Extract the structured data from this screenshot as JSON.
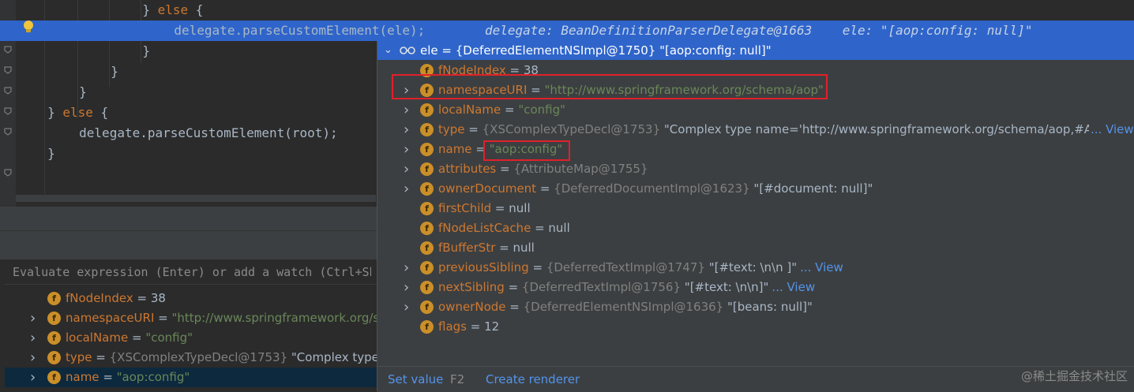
{
  "editor": {
    "lines": [
      {
        "indent": "                ",
        "parts": [
          {
            "t": "} ",
            "c": "plain"
          },
          {
            "t": "else",
            "c": "kw"
          },
          {
            "t": " {",
            "c": "plain"
          }
        ]
      },
      {
        "indent": "                    ",
        "parts": [
          {
            "t": "delegate.parseCustomElement(ele);",
            "c": "plain"
          }
        ],
        "highlight": true
      },
      {
        "indent": "                ",
        "parts": [
          {
            "t": "}",
            "c": "plain"
          }
        ]
      },
      {
        "indent": "            ",
        "parts": [
          {
            "t": "}",
            "c": "plain"
          }
        ]
      },
      {
        "indent": "        ",
        "parts": [
          {
            "t": "}",
            "c": "plain"
          }
        ]
      },
      {
        "indent": "    ",
        "parts": [
          {
            "t": "} ",
            "c": "plain"
          },
          {
            "t": "else",
            "c": "kw"
          },
          {
            "t": " {",
            "c": "plain"
          }
        ]
      },
      {
        "indent": "        ",
        "parts": [
          {
            "t": "delegate.parseCustomElement(root);",
            "c": "plain"
          }
        ]
      },
      {
        "indent": "    ",
        "parts": [
          {
            "t": "}",
            "c": "plain"
          }
        ]
      }
    ],
    "inline_hint": "delegate: BeanDefinitionParserDelegate@1663    ele: \"[aop:config: null]\""
  },
  "debug_panel": {
    "eval_placeholder": "Evaluate expression (Enter) or add a watch (Ctrl+Shift+Enter)",
    "rows": [
      {
        "expandable": false,
        "name": "fNodeIndex",
        "eq": " = ",
        "value": "38",
        "vclass": "plain"
      },
      {
        "expandable": true,
        "name": "namespaceURI",
        "eq": " = ",
        "value": "\"http://www.springframework.org/schema/aop\"",
        "vclass": "str"
      },
      {
        "expandable": true,
        "name": "localName",
        "eq": " = ",
        "value": "\"config\"",
        "vclass": "str"
      },
      {
        "expandable": true,
        "name": "type",
        "eq": " = ",
        "type": "{XSComplexTypeDecl@1753}",
        "value": " \"Complex type name='http://www.springframework.org/schema/aop,#AnonType_configType'\"",
        "vclass": "plain"
      },
      {
        "expandable": true,
        "name": "name",
        "eq": " = ",
        "value": "\"aop:config\"",
        "vclass": "str",
        "selected": true
      }
    ]
  },
  "popup": {
    "header": "ele = {DeferredElementNSImpl@1750} \"[aop:config: null]\"",
    "rows": [
      {
        "expandable": false,
        "name": "fNodeIndex",
        "eq": " = ",
        "value": "38",
        "vclass": "plain"
      },
      {
        "expandable": true,
        "name": "namespaceURI",
        "eq": " = ",
        "value": "\"http://www.springframework.org/schema/aop\"",
        "vclass": "str"
      },
      {
        "expandable": true,
        "name": "localName",
        "eq": " = ",
        "value": "\"config\"",
        "vclass": "str"
      },
      {
        "expandable": true,
        "name": "type",
        "eq": " = ",
        "type": "{XSComplexTypeDecl@1753}",
        "value": " \"Complex type name='http://www.springframework.org/schema/aop,#Anon",
        "vclass": "plain",
        "link": "... View"
      },
      {
        "expandable": true,
        "name": "name",
        "eq": " = ",
        "value": "\"aop:config\"",
        "vclass": "str"
      },
      {
        "expandable": true,
        "name": "attributes",
        "eq": " = ",
        "type": "{AttributeMap@1755}",
        "value": "",
        "vclass": "plain"
      },
      {
        "expandable": true,
        "name": "ownerDocument",
        "eq": " = ",
        "type": "{DeferredDocumentImpl@1623}",
        "value": " \"[#document: null]\"",
        "vclass": "plain"
      },
      {
        "expandable": false,
        "name": "firstChild",
        "eq": " = ",
        "value": "null",
        "vclass": "plain"
      },
      {
        "expandable": false,
        "name": "fNodeListCache",
        "eq": " = ",
        "value": "null",
        "vclass": "plain"
      },
      {
        "expandable": false,
        "name": "fBufferStr",
        "eq": " = ",
        "value": "null",
        "vclass": "plain"
      },
      {
        "expandable": true,
        "name": "previousSibling",
        "eq": " = ",
        "type": "{DeferredTextImpl@1747}",
        "value": " \"[#text: \\n\\n    ]\"",
        "vclass": "plain",
        "link": "... View"
      },
      {
        "expandable": true,
        "name": "nextSibling",
        "eq": " = ",
        "type": "{DeferredTextImpl@1756}",
        "value": " \"[#text: \\n\\n]\"",
        "vclass": "plain",
        "link": "... View"
      },
      {
        "expandable": true,
        "name": "ownerNode",
        "eq": " = ",
        "type": "{DeferredElementNSImpl@1636}",
        "value": " \"[beans: null]\"",
        "vclass": "plain"
      },
      {
        "expandable": false,
        "name": "flags",
        "eq": " = ",
        "value": "12",
        "vclass": "plain"
      }
    ],
    "footer": {
      "set_value": "Set value",
      "shortcut": "F2",
      "create_renderer": "Create renderer"
    }
  },
  "watermark": "@稀土掘金技术社区",
  "colors": {
    "highlight": "#2f65ca",
    "field_icon": "#cb8f29",
    "string": "#6a8759",
    "keyword": "#cc7832",
    "link": "#5394ec",
    "annotation_box": "#e0202a"
  },
  "icons": [
    "bulb-icon",
    "fold-icon",
    "field-icon",
    "expand-arrow-icon",
    "glasses-icon",
    "list-icon"
  ]
}
